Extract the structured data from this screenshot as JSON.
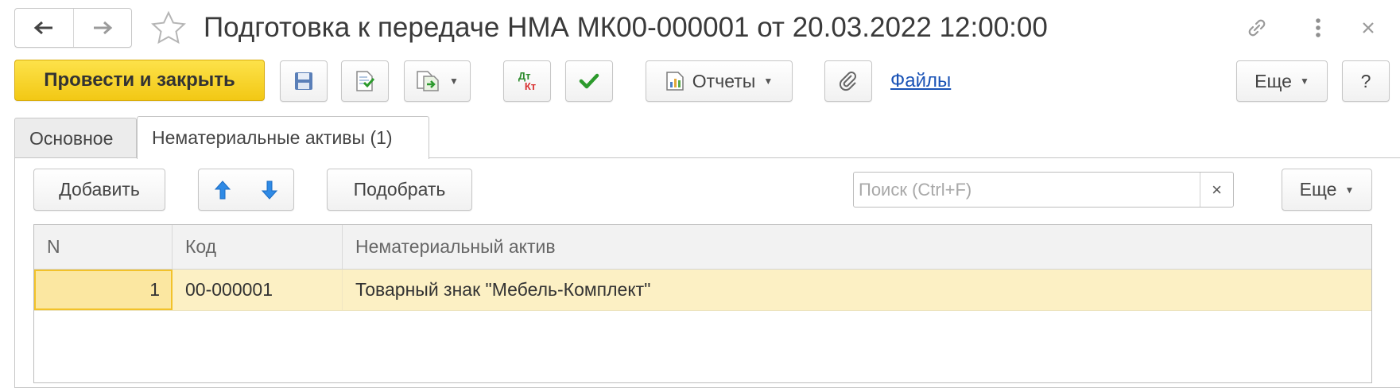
{
  "window": {
    "title": "Подготовка к передаче НМА МК00-000001 от 20.03.2022 12:00:00",
    "back_icon": "arrow-left-icon",
    "forward_icon": "arrow-right-icon",
    "favorite_icon": "star-outline-icon",
    "link_icon": "link-icon",
    "more_icon": "vertical-dots-icon",
    "close_icon": "close-icon"
  },
  "toolbar": {
    "post_and_close": "Провести и закрыть",
    "save_icon": "floppy-disk-icon",
    "post_icon": "post-document-icon",
    "create_based_icon": "create-based-on-icon",
    "dt_kt_label_top": "Дт",
    "dt_kt_label_bottom": "Кт",
    "check_icon": "checkmark-icon",
    "reports_label": "Отчеты",
    "attach_icon": "paperclip-icon",
    "files_link": "Файлы",
    "more_label": "Еще",
    "help_label": "?"
  },
  "tabs": [
    {
      "label": "Основное",
      "active": false
    },
    {
      "label": "Нематериальные активы (1)",
      "active": true
    }
  ],
  "table_toolbar": {
    "add_label": "Добавить",
    "move_up_icon": "arrow-up-icon",
    "move_down_icon": "arrow-down-icon",
    "pick_label": "Подобрать",
    "search_placeholder": "Поиск (Ctrl+F)",
    "search_value": "",
    "search_clear": "×",
    "more_label": "Еще"
  },
  "grid": {
    "columns": [
      "N",
      "Код",
      "Нематериальный актив"
    ],
    "rows": [
      {
        "n": "1",
        "code": "00-000001",
        "asset": "Товарный знак \"Мебель-Комплект\""
      }
    ]
  },
  "colors": {
    "primary_button": "#f5cf1f",
    "link": "#1a53b6",
    "selected_row": "#fcf0c4",
    "selected_cell_border": "#f2c22a",
    "arrow_blue": "#2f8ae5",
    "check_green": "#2c9a2c",
    "dt_green": "#2c8a2c",
    "kt_red": "#d93030"
  }
}
